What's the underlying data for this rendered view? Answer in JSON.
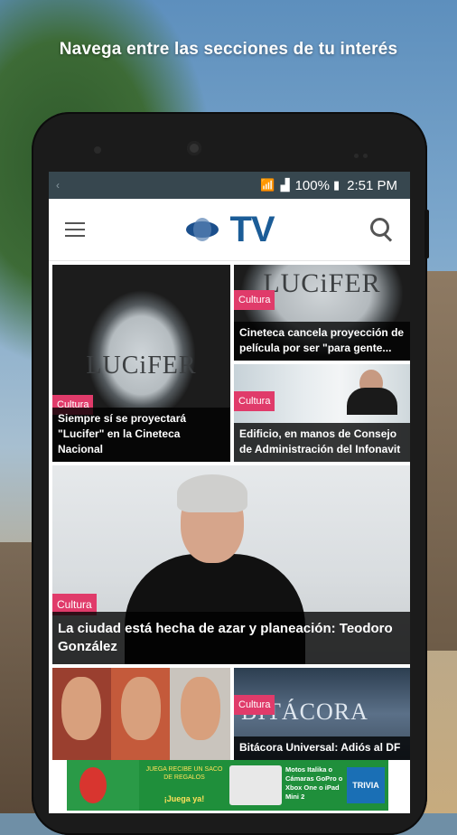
{
  "promo": {
    "headline": "Navega entre las secciones de tu interés"
  },
  "statusbar": {
    "battery": "100%",
    "time": "2:51 PM"
  },
  "toolbar": {
    "logo_text": "TV"
  },
  "articles": [
    {
      "badge": "Cultura",
      "title": "Siempre sí se proyectará \"Lucifer\" en la Cineteca Nacional",
      "image_text": "LUCiFER"
    },
    {
      "badge": "Cultura",
      "title": "Cineteca cancela proyección de película por ser \"para gente...",
      "image_text": "LUCiFER"
    },
    {
      "badge": "Cultura",
      "title": "Edificio, en manos de Consejo de Administración del Infonavit"
    },
    {
      "badge": "Cultura",
      "title": "La ciudad está hecha de azar y planeación: Teodoro González"
    },
    {
      "title": ""
    },
    {
      "badge": "Cultura",
      "title": "Bitácora Universal: Adiós al DF",
      "image_text": "BITÁCORA"
    }
  ],
  "ad": {
    "promo_top": "JUEGA RECIBE UN SACO DE REGALOS",
    "promo_bottom": "¡Juega ya!",
    "promo_right": "Motos Italika o Cámaras GoPro o Xbox One o iPad Mini 2",
    "trivia": "TRIVIA"
  }
}
